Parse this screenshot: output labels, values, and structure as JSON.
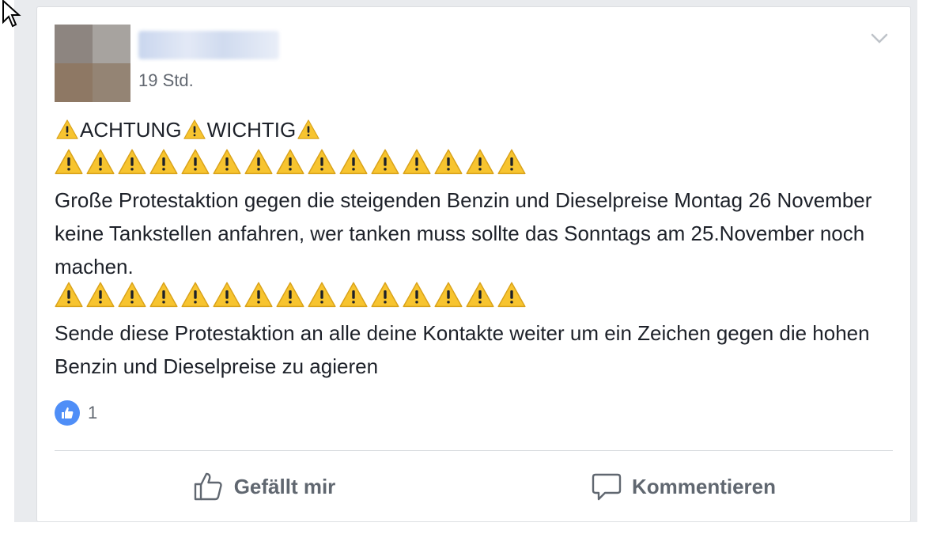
{
  "post": {
    "timestamp": "19 Std.",
    "headline": {
      "word1": "ACHTUNG",
      "word2": "WICHTIG"
    },
    "warning_row_count": 15,
    "paragraph1": "Große Protestaktion gegen die steigenden Benzin und Dieselpreise Montag 26 November keine Tankstellen anfahren, wer tanken muss sollte das Sonntags am 25.November noch machen.",
    "paragraph2": "Sende diese Protestaktion an alle deine Kontakte weiter um ein Zeichen gegen die hohen Benzin und Dieselpreise zu agieren"
  },
  "reactions": {
    "icon": "like-icon",
    "count": "1"
  },
  "actions": {
    "like_label": "Gefällt mir",
    "comment_label": "Kommentieren"
  },
  "colors": {
    "warning_yellow": "#f7c42f",
    "like_blue": "#4f8ef7",
    "text": "#1d2129",
    "muted": "#616770"
  }
}
